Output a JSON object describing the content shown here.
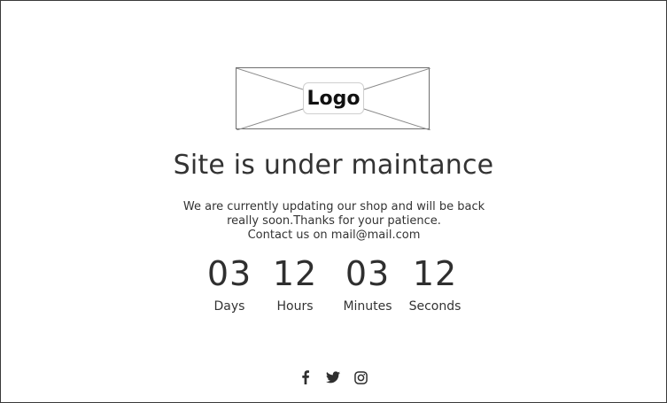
{
  "logo": {
    "label": "Logo"
  },
  "heading": "Site is under maintance",
  "message": {
    "line1": "We are currently updating our shop and will be back",
    "line2": "really soon.Thanks for your patience.",
    "line3": "Contact us on mail@mail.com"
  },
  "countdown": [
    {
      "value": "03",
      "label": "Days"
    },
    {
      "value": "12",
      "label": "Hours"
    },
    {
      "value": "03",
      "label": "Minutes"
    },
    {
      "value": "12",
      "label": "Seconds"
    }
  ],
  "social": {
    "icons": [
      "facebook-icon",
      "twitter-icon",
      "instagram-icon"
    ]
  },
  "colors": {
    "text": "#333333",
    "border": "#3a3a3a",
    "background": "#ffffff"
  }
}
